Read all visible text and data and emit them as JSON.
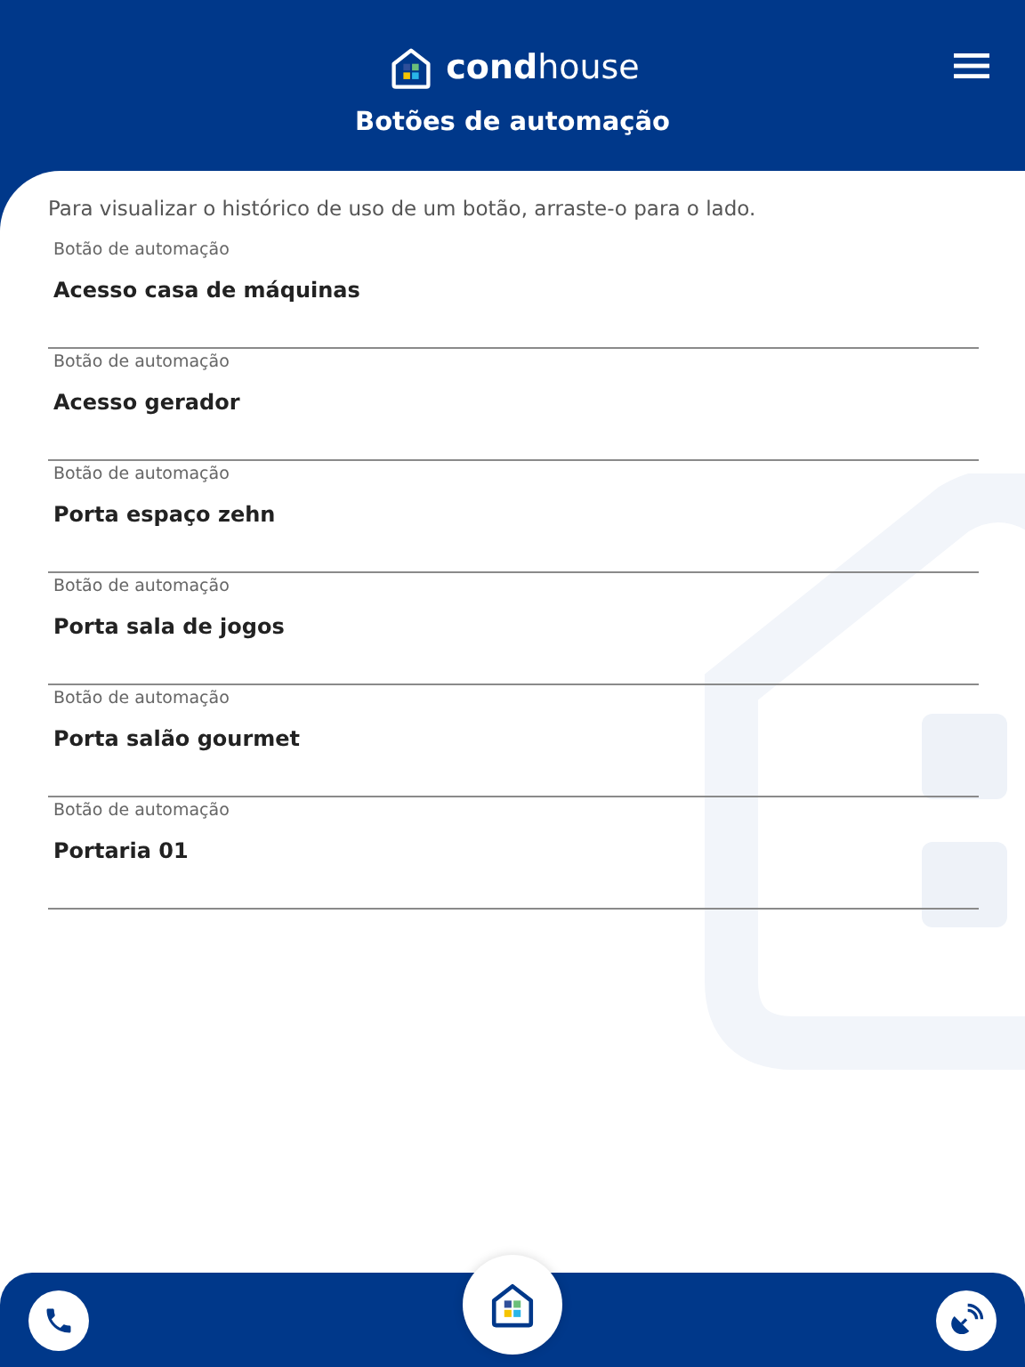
{
  "header": {
    "logo": "**cond**house",
    "title": "Botões de automação"
  },
  "hint": "Para visualizar o histórico de uso de um botão, arraste-o para o lado.",
  "buttons": [
    {
      "label": "Botão de automação",
      "name": "Acesso casa de máquinas"
    },
    {
      "label": "Botão de automação",
      "name": "Acesso gerador"
    },
    {
      "label": "Botão de automação",
      "name": "Porta espaço zehn"
    },
    {
      "label": "Botão de automação",
      "name": "Porta sala de jogos"
    },
    {
      "label": "Botão de automação",
      "name": "Porta salão gourmet"
    },
    {
      "label": "Botão de automação",
      "name": "Portaria 01"
    }
  ]
}
